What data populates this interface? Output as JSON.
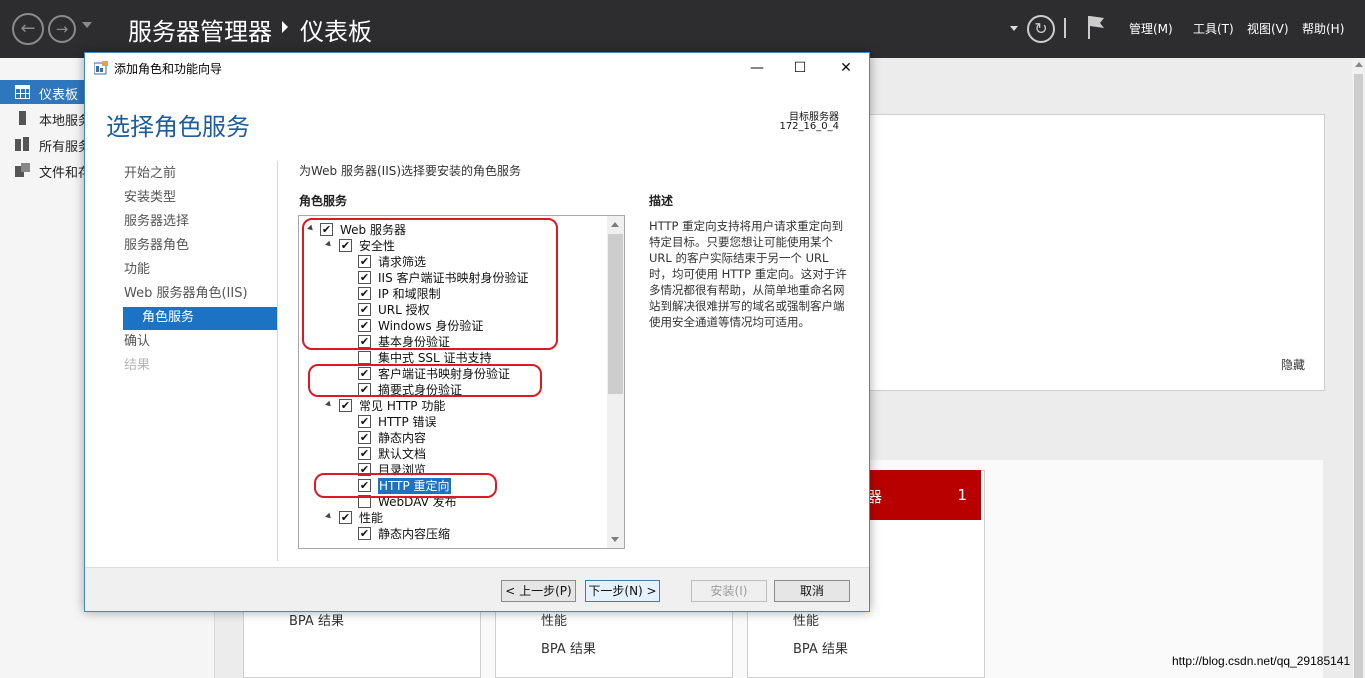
{
  "server_manager": {
    "title": "服务器管理器",
    "page": "仪表板",
    "menus": [
      "管理(M)",
      "工具(T)",
      "视图(V)",
      "帮助(H)"
    ]
  },
  "sidebar": {
    "items": [
      {
        "label": "仪表板",
        "icon": "dashboard-icon",
        "active": true
      },
      {
        "label": "本地服务",
        "icon": "server-icon"
      },
      {
        "label": "所有服务",
        "icon": "servers-icon"
      },
      {
        "label": "文件和存",
        "icon": "storage-icon"
      }
    ]
  },
  "background": {
    "hide": "隐藏",
    "tile_count": "1",
    "tile_title": "器",
    "tiles": [
      {
        "line1": "",
        "line2": "BPA 结果"
      },
      {
        "line1": "性能",
        "line2": "BPA 结果"
      },
      {
        "line1": "性能",
        "line2": "BPA 结果"
      }
    ]
  },
  "watermark": "http://blog.csdn.net/qq_29185141",
  "dialog": {
    "title": "添加角色和功能向导",
    "heading": "选择角色服务",
    "target_label": "目标服务器",
    "target_value": "172_16_0_4",
    "steps": [
      {
        "label": "开始之前",
        "state": "normal"
      },
      {
        "label": "安装类型",
        "state": "normal"
      },
      {
        "label": "服务器选择",
        "state": "normal"
      },
      {
        "label": "服务器角色",
        "state": "normal"
      },
      {
        "label": "功能",
        "state": "normal"
      },
      {
        "label": "Web 服务器角色(IIS)",
        "state": "normal"
      },
      {
        "label": "角色服务",
        "state": "active"
      },
      {
        "label": "确认",
        "state": "normal"
      },
      {
        "label": "结果",
        "state": "disabled"
      }
    ],
    "instruction": "为Web 服务器(IIS)选择要安装的角色服务",
    "roles_header": "角色服务",
    "description_header": "描述",
    "description": "HTTP 重定向支持将用户请求重定向到特定目标。只要您想让可能使用某个 URL 的客户实际结束于另一个 URL 时，均可使用 HTTP 重定向。这对于许多情况都很有帮助，从简单地重命名网站到解决很难拼写的域名或强制客户端使用安全通道等情况均可适用。",
    "tree": [
      {
        "label": "Web 服务器",
        "level": 0,
        "expand": true,
        "checked": true
      },
      {
        "label": "安全性",
        "level": 1,
        "expand": true,
        "checked": true
      },
      {
        "label": "请求筛选",
        "level": 2,
        "checked": true
      },
      {
        "label": "IIS 客户端证书映射身份验证",
        "level": 2,
        "checked": true
      },
      {
        "label": "IP 和域限制",
        "level": 2,
        "checked": true
      },
      {
        "label": "URL 授权",
        "level": 2,
        "checked": true
      },
      {
        "label": "Windows 身份验证",
        "level": 2,
        "checked": true
      },
      {
        "label": "基本身份验证",
        "level": 2,
        "checked": true
      },
      {
        "label": "集中式 SSL 证书支持",
        "level": 2,
        "checked": false
      },
      {
        "label": "客户端证书映射身份验证",
        "level": 2,
        "checked": true
      },
      {
        "label": "摘要式身份验证",
        "level": 2,
        "checked": true
      },
      {
        "label": "常见 HTTP 功能",
        "level": 1,
        "expand": true,
        "checked": true
      },
      {
        "label": "HTTP 错误",
        "level": 2,
        "checked": true
      },
      {
        "label": "静态内容",
        "level": 2,
        "checked": true
      },
      {
        "label": "默认文档",
        "level": 2,
        "checked": true
      },
      {
        "label": "目录浏览",
        "level": 2,
        "checked": true
      },
      {
        "label": "HTTP 重定向",
        "level": 2,
        "checked": true,
        "selected": true
      },
      {
        "label": "WebDAV 发布",
        "level": 2,
        "checked": false
      },
      {
        "label": "性能",
        "level": 1,
        "expand": true,
        "checked": true
      },
      {
        "label": "静态内容压缩",
        "level": 2,
        "checked": true
      }
    ],
    "buttons": {
      "prev": "< 上一步(P)",
      "next": "下一步(N) >",
      "install": "安装(I)",
      "cancel": "取消"
    }
  },
  "colors": {
    "accent": "#1c73c4",
    "title_blue": "#1e5d9b",
    "annotation_red": "#d91c24",
    "tile_red": "#b80000"
  }
}
